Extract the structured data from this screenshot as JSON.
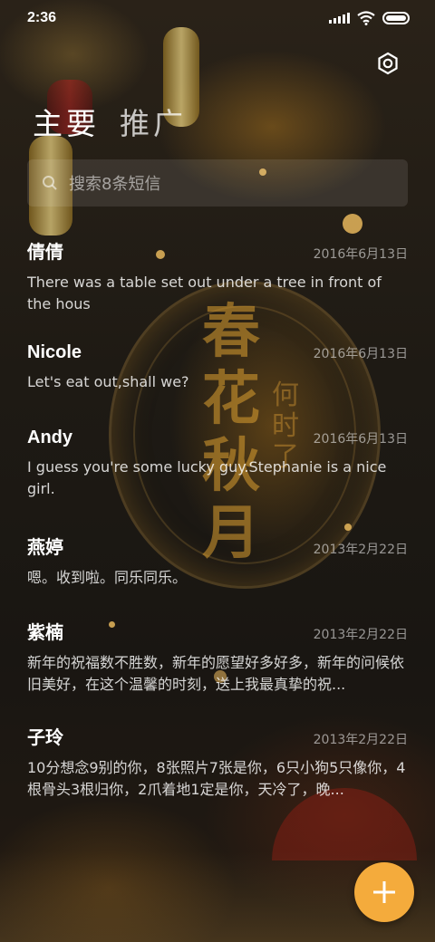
{
  "status_bar": {
    "time": "2:36"
  },
  "tabs": [
    {
      "label": "主要",
      "active": true
    },
    {
      "label": "推广",
      "active": false
    }
  ],
  "search": {
    "placeholder": "搜索8条短信"
  },
  "messages": [
    {
      "name": "倩倩",
      "date": "2016年6月13日",
      "preview": "There was a table set out under a tree in front of the hous"
    },
    {
      "name": "Nicole",
      "date": "2016年6月13日",
      "preview": "Let's eat out,shall we?"
    },
    {
      "name": "Andy",
      "date": "2016年6月13日",
      "preview": "I guess you're some lucky guy.Stephanie is a nice girl."
    },
    {
      "name": "燕婷",
      "date": "2013年2月22日",
      "preview": "嗯。收到啦。同乐同乐。"
    },
    {
      "name": "紫楠",
      "date": "2013年2月22日",
      "preview": "新年的祝福数不胜数，新年的愿望好多好多，新年的问候依旧美好，在这个温馨的时刻，送上我最真挚的祝..."
    },
    {
      "name": "子玲",
      "date": "2013年2月22日",
      "preview": "10分想念9别的你，8张照片7张是你，6只小狗5只像你，4根骨头3根归你，2爪着地1定是你，天冷了，晚..."
    }
  ],
  "background_art": {
    "calligraphy": "春花秋月",
    "side_text": "何时了"
  },
  "colors": {
    "fab": "#f4ab3c",
    "text": "#ffffff"
  },
  "icons": {
    "settings": "gear-icon",
    "search": "search-icon",
    "fab": "plus-icon"
  }
}
